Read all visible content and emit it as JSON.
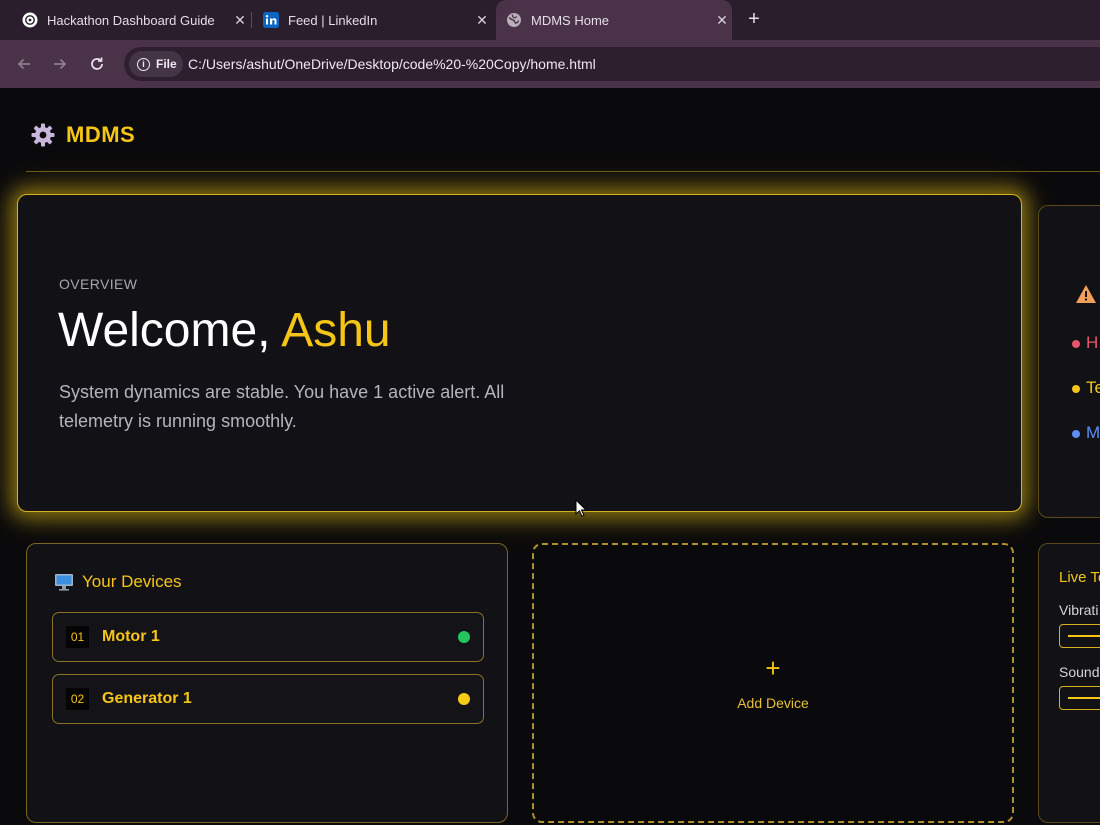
{
  "browser": {
    "tabs": [
      {
        "title": "Hackathon Dashboard Guide",
        "icon": "chatgpt-icon"
      },
      {
        "title": "Feed | LinkedIn",
        "icon": "linkedin-icon"
      },
      {
        "title": "MDMS Home",
        "icon": "globe-icon",
        "active": true
      }
    ],
    "close_glyph": "✕",
    "new_tab_glyph": "+",
    "chip_label": "File",
    "url": "C:/Users/ashut/OneDrive/Desktop/code%20-%20Copy/home.html"
  },
  "app": {
    "brand": "MDMS",
    "accent_color": "#f5c518",
    "hero": {
      "eyebrow": "OVERVIEW",
      "greeting": "Welcome, ",
      "user": "Ashu",
      "message": "System dynamics are stable. You have 1 active alert. All telemetry is running smoothly."
    },
    "alerts": {
      "icon": "warning-icon",
      "items": [
        {
          "text": "H",
          "color": "#e8566a"
        },
        {
          "text": "Te",
          "color": "#f5c518"
        },
        {
          "text": "M",
          "color": "#5b8ef5"
        }
      ]
    },
    "devices": {
      "title": "Your Devices",
      "items": [
        {
          "num": "01",
          "name": "Motor 1",
          "status_color": "#22c55e"
        },
        {
          "num": "02",
          "name": "Generator 1",
          "status_color": "#facc15"
        }
      ]
    },
    "add_device": {
      "plus": "+",
      "label": "Add Device"
    },
    "telemetry": {
      "title": "Live Te",
      "metrics": [
        {
          "label": "Vibrati"
        },
        {
          "label": "Sound"
        }
      ]
    }
  }
}
